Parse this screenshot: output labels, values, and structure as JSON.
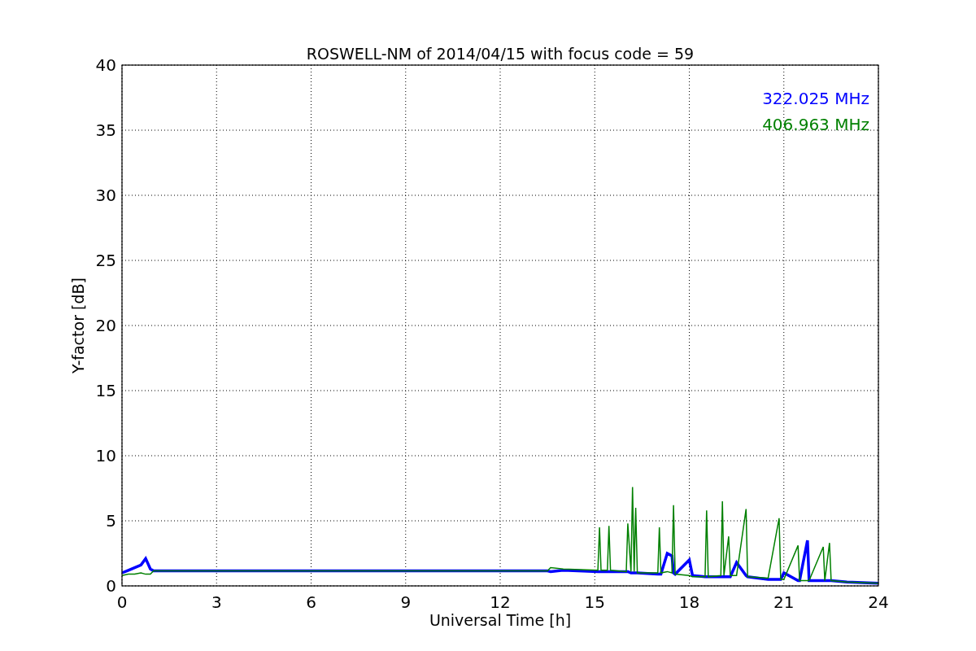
{
  "chart_data": {
    "type": "line",
    "title": "ROSWELL-NM of 2014/04/15 with focus code = 59",
    "xlabel": "Universal Time [h]",
    "ylabel": "Y-factor [dB]",
    "xlim": [
      0,
      24
    ],
    "ylim": [
      0,
      40
    ],
    "grid": true,
    "xticks": [
      0,
      3,
      6,
      9,
      12,
      15,
      18,
      21,
      24
    ],
    "yticks": [
      0,
      5,
      10,
      15,
      20,
      25,
      30,
      35,
      40
    ],
    "x": [
      0,
      0.2,
      0.4,
      0.6,
      0.75,
      0.9,
      1.0,
      13.5,
      13.6,
      14.0,
      15.1,
      15.15,
      15.2,
      15.4,
      15.45,
      15.5,
      16.0,
      16.05,
      16.15,
      16.2,
      16.25,
      16.3,
      16.35,
      17.0,
      17.05,
      17.1,
      17.3,
      17.45,
      17.5,
      17.55,
      18.0,
      18.1,
      18.5,
      18.55,
      18.6,
      19.0,
      19.05,
      19.1,
      19.25,
      19.3,
      19.5,
      19.8,
      19.85,
      20.5,
      20.85,
      20.9,
      21.0,
      21.45,
      21.5,
      21.75,
      21.8,
      22.25,
      22.3,
      22.45,
      22.5,
      23.0,
      24.0
    ],
    "series": [
      {
        "name": "322.025 MHz",
        "color": "#0000ff",
        "values": [
          1.0,
          1.2,
          1.4,
          1.6,
          2.1,
          1.3,
          1.15,
          1.15,
          1.1,
          1.2,
          1.1,
          1.1,
          1.1,
          1.1,
          1.1,
          1.1,
          1.1,
          1.1,
          1.0,
          1.0,
          1.0,
          1.0,
          1.0,
          0.9,
          0.9,
          0.9,
          2.5,
          2.3,
          1.0,
          0.9,
          2.0,
          0.8,
          0.7,
          0.7,
          0.7,
          0.7,
          0.7,
          0.7,
          0.7,
          0.7,
          1.8,
          0.8,
          0.7,
          0.5,
          0.5,
          0.5,
          1.0,
          0.4,
          0.4,
          3.5,
          0.4,
          0.4,
          0.4,
          0.4,
          0.4,
          0.3,
          0.2
        ]
      },
      {
        "name": "406.963 MHz",
        "color": "#008000",
        "values": [
          0.8,
          0.9,
          0.9,
          1.0,
          0.9,
          0.9,
          1.15,
          1.15,
          1.4,
          1.3,
          1.2,
          4.5,
          1.2,
          1.2,
          4.6,
          1.2,
          1.1,
          4.8,
          1.1,
          7.6,
          1.1,
          6.0,
          1.0,
          1.0,
          4.5,
          1.0,
          1.1,
          1.0,
          6.2,
          0.9,
          0.8,
          0.7,
          0.7,
          5.8,
          0.7,
          0.8,
          6.5,
          0.8,
          3.8,
          0.8,
          0.8,
          5.9,
          0.7,
          0.6,
          5.2,
          0.5,
          0.5,
          3.1,
          0.4,
          0.4,
          0.4,
          3.0,
          0.4,
          3.3,
          0.4,
          0.3,
          0.2
        ]
      }
    ]
  }
}
